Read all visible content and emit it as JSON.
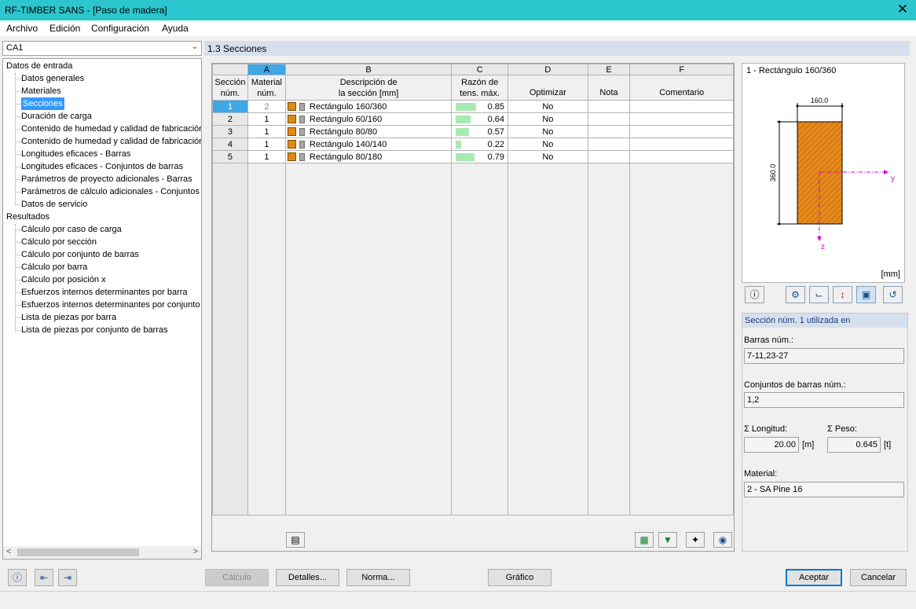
{
  "window": {
    "title": "RF-TIMBER SANS - [Paso de madera]",
    "close_glyph": "✕"
  },
  "menu": [
    "Archivo",
    "Edición",
    "Configuración",
    "Ayuda"
  ],
  "case_select": {
    "value": "CA1"
  },
  "nav": {
    "input_title": "Datos de entrada",
    "input_items": [
      "Datos generales",
      "Materiales",
      "Secciones",
      "Duración de carga",
      "Contenido de humedad y calidad de fabricación",
      "Contenido de humedad y calidad de fabricación",
      "Longitudes eficaces - Barras",
      "Longitudes eficaces - Conjuntos de barras",
      "Parámetros de proyecto adicionales - Barras",
      "Parámetros de cálculo adicionales - Conjuntos de barras",
      "Datos de servicio"
    ],
    "selected_index": 2,
    "results_title": "Resultados",
    "results_items": [
      "Cálculo por caso de carga",
      "Cálculo por sección",
      "Cálculo por conjunto de barras",
      "Cálculo por barra",
      "Cálculo por posición x",
      "Esfuerzos internos determinantes por barra",
      "Esfuerzos internos determinantes por conjunto",
      "Lista de piezas por barra",
      "Lista de piezas por conjunto de barras"
    ]
  },
  "section_title": "1.3 Secciones",
  "table": {
    "col_letters": [
      "A",
      "B",
      "C",
      "D",
      "E",
      "F"
    ],
    "headers": {
      "rownum": [
        "Sección",
        "núm."
      ],
      "material": [
        "Material",
        "núm."
      ],
      "desc": [
        "Descripción de",
        "la sección [mm]"
      ],
      "ratio": [
        "Razón de",
        "tens. máx."
      ],
      "optimize": "Optimizar",
      "note": "Nota",
      "comment": "Comentario"
    },
    "rows": [
      {
        "num": "1",
        "material": "2",
        "desc": "Rectángulo 160/360",
        "ratio": "0.85",
        "ratio_value": 0.85,
        "optimize": "No",
        "note": "",
        "comment": ""
      },
      {
        "num": "2",
        "material": "1",
        "desc": "Rectángulo 60/160",
        "ratio": "0.64",
        "ratio_value": 0.64,
        "optimize": "No",
        "note": "",
        "comment": ""
      },
      {
        "num": "3",
        "material": "1",
        "desc": "Rectángulo 80/80",
        "ratio": "0.57",
        "ratio_value": 0.57,
        "optimize": "No",
        "note": "",
        "comment": ""
      },
      {
        "num": "4",
        "material": "1",
        "desc": "Rectángulo 140/140",
        "ratio": "0.22",
        "ratio_value": 0.22,
        "optimize": "No",
        "note": "",
        "comment": ""
      },
      {
        "num": "5",
        "material": "1",
        "desc": "Rectángulo 80/180",
        "ratio": "0.79",
        "ratio_value": 0.79,
        "optimize": "No",
        "note": "",
        "comment": ""
      }
    ]
  },
  "preview": {
    "title": "1 - Rectángulo 160/360",
    "width_label": "160.0",
    "height_label": "360.0",
    "axis_y": "y",
    "axis_z": "z",
    "unit": "[mm]"
  },
  "info": {
    "header": "Sección núm. 1 utilizada en",
    "members_label": "Barras núm.:",
    "members_value": "7-11,23-27",
    "sets_label": "Conjuntos de barras núm.:",
    "sets_value": "1,2",
    "length_label": "Σ Longitud:",
    "length_value": "20.00",
    "length_unit": "[m]",
    "weight_label": "Σ Peso:",
    "weight_value": "0.645",
    "weight_unit": "[t]",
    "material_label": "Material:",
    "material_value": "2 - SA Pine 16"
  },
  "buttons": {
    "calc": "Cálculo",
    "details": "Detalles...",
    "norm": "Norma...",
    "graphic": "Gráfico",
    "accept": "Aceptar",
    "cancel": "Cancelar"
  },
  "icons": {
    "help": "?",
    "info": "i"
  }
}
